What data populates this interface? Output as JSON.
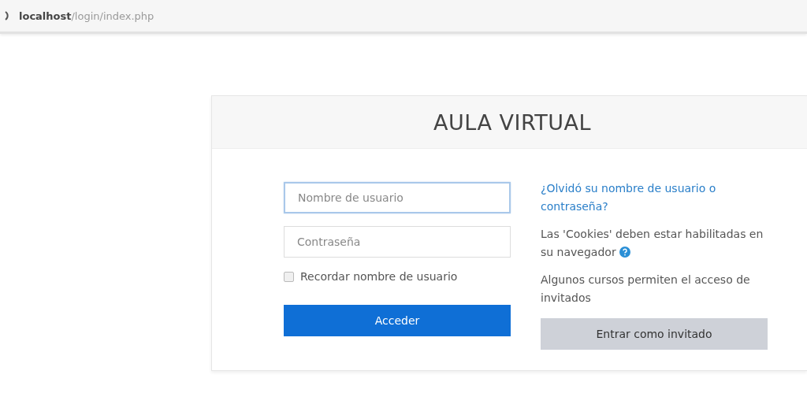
{
  "address_bar": {
    "url": "**localhost**/login/index.php"
  },
  "login": {
    "title": "AULA VIRTUAL",
    "username": {
      "placeholder": "Nombre de usuario",
      "focused": true
    },
    "password": {
      "placeholder": "Contraseña",
      "focused": false
    },
    "remember": {
      "label": "Recordar nombre de usuario",
      "checked": false
    },
    "submit": "Acceder",
    "forgot_link": "¿Olvidó su nombre de usuario o contraseña?",
    "cookies_note": "Las 'Cookies' deben estar habilitadas en su navegador",
    "guest_note": "Algunos cursos permiten el acceso de invitados",
    "guest_button": "Entrar como invitado"
  }
}
